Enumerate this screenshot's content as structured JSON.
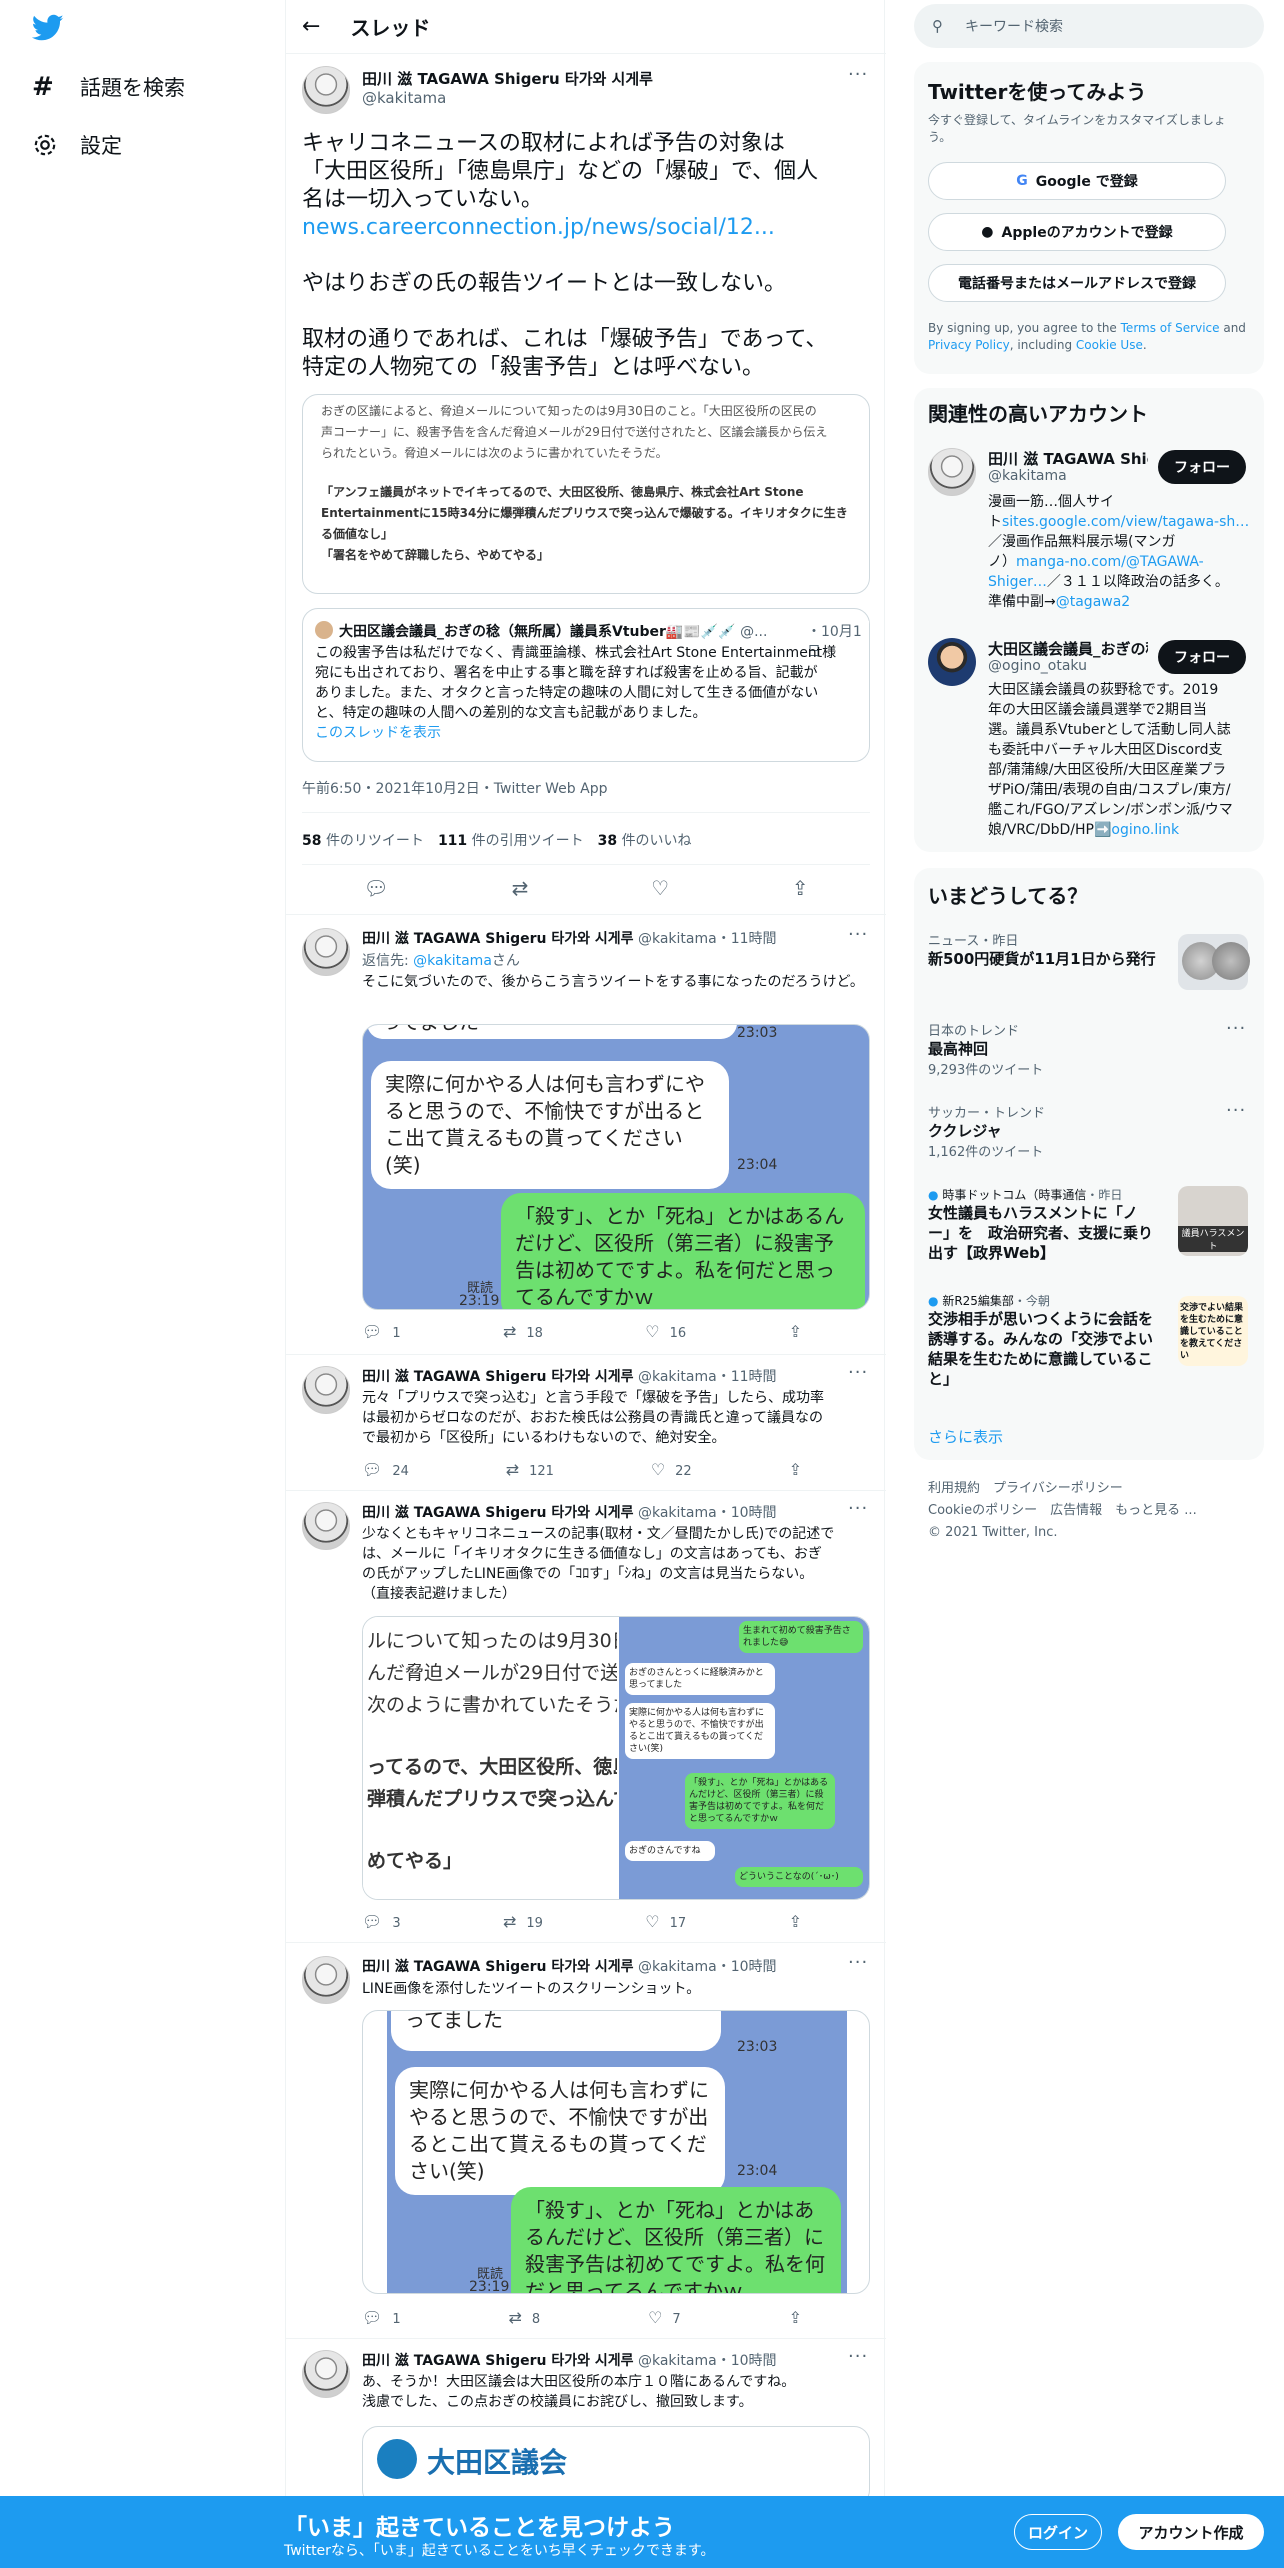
{
  "nav": {
    "search_label": "話題を検索",
    "settings_label": "設定"
  },
  "header": {
    "title": "スレッド"
  },
  "main_tweet": {
    "name": "田川 滋 TAGAWA Shigeru 타가와 시게루",
    "handle": "@kakitama",
    "line1": "キャリコネニュースの取材によれば予告の対象は",
    "line2": "「大田区役所」「徳島県庁」などの「爆破」で、個人",
    "line3": "名は一切入っていない。",
    "link": "news.careerconnection.jp/news/social/12...",
    "line4": "やはりおぎの氏の報告ツイートとは一致しない。",
    "line5": "取材の通りであれば、これは「爆破予告」であって、",
    "line6": "特定の人物宛ての「殺害予告」とは呼べない。",
    "quote_img": {
      "l1": "おぎの区議によると、脅迫メールについて知ったのは9月30日のこと。「大田区役所の区民の",
      "l2": "声コーナー」に、殺害予告を含んだ脅迫メールが29日付で送付されたと、区議会議長から伝え",
      "l3": "られたという。脅迫メールには次のように書かれていたそうだ。",
      "b1": "「アンフェ議員がネットでイキってるので、大田区役所、徳島県庁、株式会社Art Stone",
      "b2": "Entertainmentに15時34分に爆弾積んだプリウスで突っ込んで爆破する。イキリオタクに生き",
      "b3": "る価値なし」",
      "b4": "「署名をやめて辞職したら、やめてやる」"
    },
    "quoted": {
      "name": "大田区議会議員_おぎの稔（無所属）議員系Vtuber",
      "emoji": "🏭📰💉💉",
      "handle": "@...",
      "date": "10月1日",
      "l1": "この殺害予告は私だけでなく、青識亜論様、株式会社Art Stone Entertainment様",
      "l2": "宛にも出されており、署名を中止する事と職を辞すれば殺害を止める旨、記載が",
      "l3": "ありました。また、オタクと言った特定の趣味の人間に対して生きる価値がない",
      "l4": "と、特定の趣味の人間への差別的な文言も記載がありました。",
      "thread_link": "このスレッドを表示"
    },
    "meta": "午前6:50・2021年10月2日・Twitter Web App",
    "stats": {
      "rt_count": "58",
      "rt_label": "件のリツイート",
      "qt_count": "111",
      "qt_label": "件の引用ツイート",
      "like_count": "38",
      "like_label": "件のいいね"
    }
  },
  "chat": {
    "partial": "ってました",
    "t1": "23:03",
    "w1": "実際に何かやる人は何も言わずにやると思うので、不愉快ですが出るとこ出て貰えるもの貰ってください(笑)",
    "t2": "23:04",
    "g1": "「殺す」、とか「死ね」とかはあるんだけど、区役所（第三者）に殺害予告は初めてですよ。私を何だと思ってるんですかｗ",
    "read": "既読",
    "t3": "23:19"
  },
  "replies": [
    {
      "name": "田川 滋 TAGAWA Shigeru 타가와 시게루",
      "handle": "@kakitama",
      "time": "・11時間",
      "reply_prefix": "返信先: ",
      "reply_to": "@kakitama",
      "reply_suffix": "さん",
      "text": "そこに気づいたので、後からこう言うツイートをする事になったのだろうけど。",
      "replies": "1",
      "retweets": "18",
      "likes": "16"
    },
    {
      "name": "田川 滋 TAGAWA Shigeru 타가와 시게루",
      "handle": "@kakitama",
      "time": "・11時間",
      "l1": "元々「プリウスで突っ込む」と言う手段で「爆破を予告」したら、成功率",
      "l2": "は最初からゼロなのだが、おおた検氏は公務員の青識氏と違って議員なの",
      "l3": "で最初から「区役所」にいるわけもないので、絶対安全。",
      "replies": "24",
      "retweets": "121",
      "likes": "22"
    },
    {
      "name": "田川 滋 TAGAWA Shigeru 타가와 시게루",
      "handle": "@kakitama",
      "time": "・10時間",
      "l1": "少なくともキャリコネニュースの記事(取材・文／昼間たかし氏)での記述で",
      "l2": "は、メールに「イキリオタクに生きる価値なし」の文言はあっても、おぎ",
      "l3": "の氏がアップしたLINE画像での「ｺﾛす」「ｼね」の文言は見当たらない。",
      "l4": "（直接表記避けました）",
      "replies": "3",
      "retweets": "19",
      "likes": "17"
    },
    {
      "name": "田川 滋 TAGAWA Shigeru 타가와 시게루",
      "handle": "@kakitama",
      "time": "・10時間",
      "text": "LINE画像を添付したツイートのスクリーンショット。",
      "replies": "1",
      "retweets": "8",
      "likes": "7"
    },
    {
      "name": "田川 滋 TAGAWA Shigeru 타가와 시게루",
      "handle": "@kakitama",
      "time": "・10時間",
      "l1": "あ、そうか！大田区議会は大田区役所の本庁１０階にあるんですね。",
      "l2": "浅慮でした、この点おぎの校議員にお詫びし、撤回致します。",
      "img_text": "大田区議会"
    }
  ],
  "split_img": {
    "left": {
      "l1": "ルについて知ったのは9月30日の",
      "l2": "んだ脅迫メールが29日付で送付",
      "l3": "次のように書かれていたそうだ",
      "l4": "ってるので、大田区役所、徳島",
      "l5": "弾積んだプリウスで突っ込んで",
      "l6": "めてやる」"
    },
    "right": {
      "g1": "生まれて初めて殺害予告されました😅",
      "w1": "おぎのさんとっくに経験済みかと思ってました",
      "w2": "実際に何かやる人は何も言わずにやると思うので、不愉快ですが出るとこ出て貰えるもの貰ってください(笑)",
      "g2": "「殺す」、とか「死ね」とかはあるんだけど、区役所（第三者）に殺害予告は初めてですよ。私を何だと思ってるんですかｗ",
      "w3": "おぎのさんですね",
      "g3": "どういうことなの(´･ω･)"
    }
  },
  "sidebar": {
    "search_placeholder": "キーワード検索",
    "signup": {
      "title": "Twitterを使ってみよう",
      "sub1": "今すぐ登録して、タイムラインをカスタマイズしましょ",
      "sub2": "う。",
      "google": "Google で登録",
      "apple": "Appleのアカウントで登録",
      "phone": "電話番号またはメールアドレスで登録",
      "terms1": "By signing up, you agree to the ",
      "tos": "Terms of Service",
      "and": " and",
      "privacy": "Privacy Policy",
      "including": ", including ",
      "cookie": "Cookie Use",
      "dot": "."
    },
    "related": {
      "title": "関連性の高いアカウント",
      "a1": {
        "name": "田川 滋 TAGAWA Shigeru",
        "handle": "@kakitama",
        "follow": "フォロー",
        "b1": "漫画一筋…個人サイ",
        "b2": "ト",
        "b2link": "sites.google.com/view/tagawa-sh…",
        "b3": "／漫画作品無料展示場(マンガ",
        "b4": "ノ）",
        "b4link": "manga-no.com/@TAGAWA-",
        "b5link": "Shiger…",
        "b5": "／３１１以降政治の話多く。",
        "b6": "準備中副→",
        "b6link": "@tagawa2"
      },
      "a2": {
        "name": "大田区議会議員_おぎの稔",
        "handle": "@ogino_otaku",
        "follow": "フォロー",
        "b1": "大田区議会議員の荻野稔です。2019",
        "b2": "年の大田区議会議員選挙で2期目当",
        "b3": "選。議員系Vtuberとして活動し同人誌",
        "b4": "も委託中バーチャル大田区Discord支",
        "b5": "部/蒲蒲線/大田区役所/大田区産業プラ",
        "b6": "ザPiO/蒲田/表現の自由/コスプレ/東方/",
        "b7": "艦これ/FGO/アズレン/ボンボン派/ウマ",
        "b8": "娘/VRC/DbD/HP",
        "b8link": "➡️ogino.link"
      }
    },
    "trends": {
      "title": "いまどうしてる？",
      "t1": {
        "meta": "ニュース・昨日",
        "title": "新500円硬貨が11月1日から発行"
      },
      "t2": {
        "meta": "日本のトレンド",
        "title": "最高神回",
        "count": "9,293件のツイート"
      },
      "t3": {
        "meta": "サッカー・トレンド",
        "title": "ククレジャ",
        "count": "1,162件のツイート"
      },
      "t4": {
        "source": "時事ドットコム（時事通信",
        "when": "・昨日",
        "l1": "女性議員もハラスメントに「ノ",
        "l2": "ー」を　政治研究者、支援に乗り",
        "l3": "出す【政界Web】",
        "thumb": "議員ハラスメント"
      },
      "t5": {
        "source": "新R25編集部",
        "when": "・今朝",
        "l1": "交渉相手が思いつくように会話を",
        "l2": "誘導する。みんなの「交渉でよい",
        "l3": "結果を生むために意識しているこ",
        "l4": "と」",
        "thumb": "交渉でよい結果を生むために意識していることを教えてください"
      },
      "more": "さらに表示"
    },
    "footer": {
      "l1a": "利用規約",
      "l1b": "プライバシーポリシー",
      "l2a": "Cookieのポリシー",
      "l2b": "広告情報",
      "l2c": "もっと見る ...",
      "l3": "© 2021 Twitter, Inc."
    }
  },
  "bottom": {
    "title": "「いま」起きていることを見つけよう",
    "sub": "Twitterなら、「いま」起きていることをいち早くチェックできます。",
    "login": "ログイン",
    "signup": "アカウント作成"
  },
  "colors": {
    "brand": "#1d9bf0",
    "chat_bg": "#7b9bd6",
    "chat_green": "#6de06f"
  }
}
